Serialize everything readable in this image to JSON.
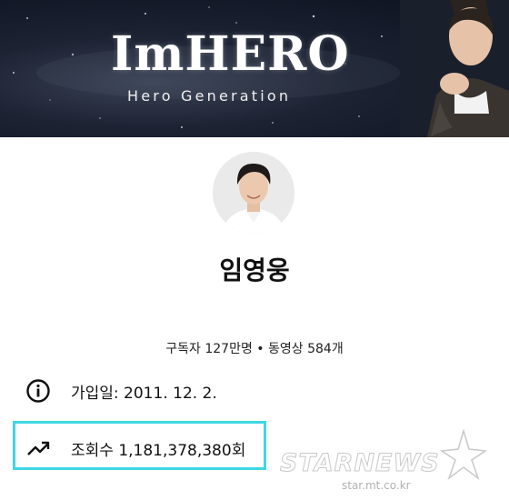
{
  "banner": {
    "title": "ImHERO",
    "subtitle": "Hero Generation"
  },
  "channel": {
    "name": "임영웅",
    "stats": "구독자 127만명 • 동영상 584개"
  },
  "details": {
    "joined": "가입일: 2011. 12. 2.",
    "views": "조회수 1,181,378,380회"
  },
  "highlight_color": "#3fd6e4",
  "watermark": {
    "brand": "STARNEWS",
    "url": "star.mt.co.kr"
  }
}
